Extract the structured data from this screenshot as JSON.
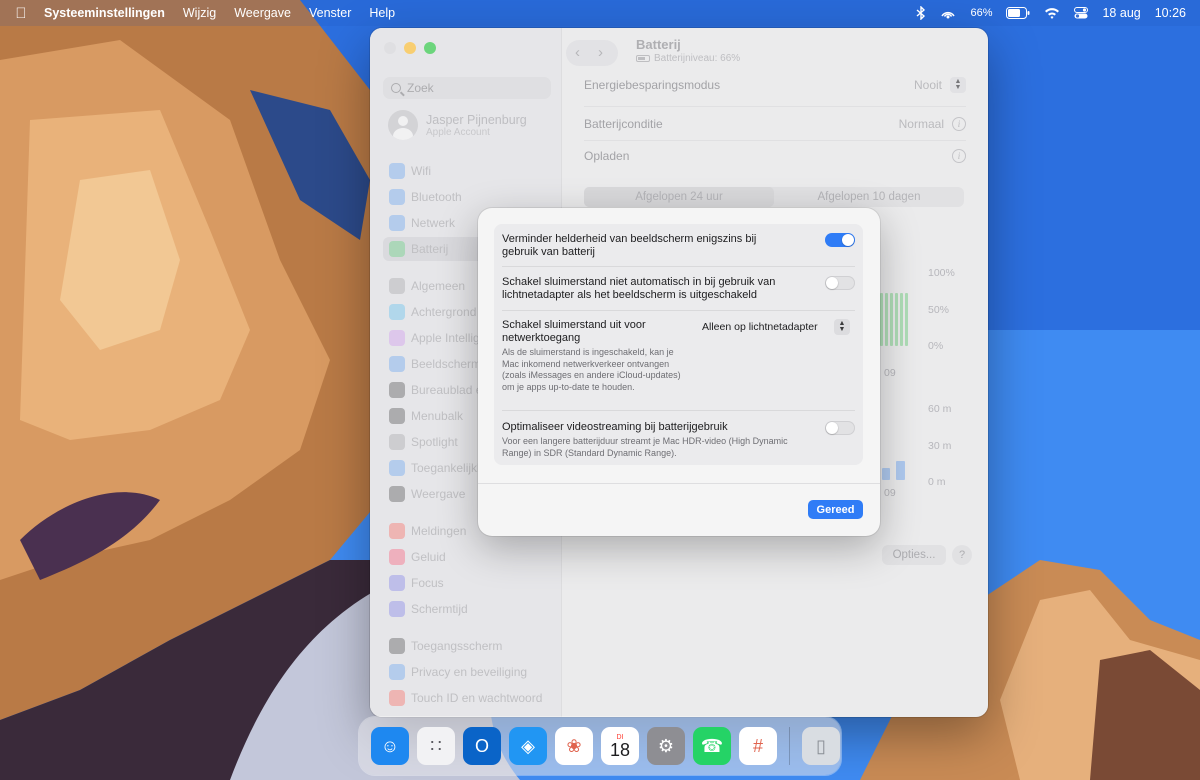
{
  "menubar": {
    "app": "Systeeminstellingen",
    "items": [
      "Wijzig",
      "Weergave",
      "Venster",
      "Help"
    ],
    "battery_pct": "66%",
    "date": "18 aug",
    "time": "10:26"
  },
  "window": {
    "title": "Batterij",
    "subtitle": "Batterijniveau: 66%"
  },
  "sidebar": {
    "search_placeholder": "Zoek",
    "account": {
      "name": "Jasper Pijnenburg",
      "sub": "Apple Account"
    },
    "items": [
      {
        "label": "Wifi",
        "icon": "wifi-icon",
        "color": "#3a8cf5"
      },
      {
        "label": "Bluetooth",
        "icon": "bluetooth-icon",
        "color": "#3a8cf5"
      },
      {
        "label": "Netwerk",
        "icon": "globe-icon",
        "color": "#3a8cf5"
      },
      {
        "label": "Batterij",
        "icon": "battery-icon",
        "color": "#34c759"
      },
      {
        "label": "Algemeen",
        "icon": "gear-icon",
        "color": "#8e8e93"
      },
      {
        "label": "Achtergrond",
        "icon": "wallpaper-icon",
        "color": "#30b0f0"
      },
      {
        "label": "Apple Intellige",
        "icon": "apple-intelligence-icon",
        "color": "#c57af0"
      },
      {
        "label": "Beeldscherme",
        "icon": "display-icon",
        "color": "#3a8cf5"
      },
      {
        "label": "Bureaublad e",
        "icon": "desktop-dock-icon",
        "color": "#1d1d1f"
      },
      {
        "label": "Menubalk",
        "icon": "menubar-icon",
        "color": "#1d1d1f"
      },
      {
        "label": "Spotlight",
        "icon": "spotlight-icon",
        "color": "#8e8e93"
      },
      {
        "label": "Toegankelijkh",
        "icon": "accessibility-icon",
        "color": "#3a8cf5"
      },
      {
        "label": "Weergave",
        "icon": "appearance-icon",
        "color": "#1d1d1f"
      },
      {
        "label": "Meldingen",
        "icon": "notifications-icon",
        "color": "#ff3b30"
      },
      {
        "label": "Geluid",
        "icon": "sound-icon",
        "color": "#ff2d55"
      },
      {
        "label": "Focus",
        "icon": "focus-moon-icon",
        "color": "#5e5ce6"
      },
      {
        "label": "Schermtijd",
        "icon": "screentime-icon",
        "color": "#5e5ce6"
      },
      {
        "label": "Toegangsscherm",
        "icon": "lockscreen-icon",
        "color": "#1d1d1f"
      },
      {
        "label": "Privacy en beveiliging",
        "icon": "privacy-hand-icon",
        "color": "#3a8cf5"
      },
      {
        "label": "Touch ID en wachtwoord",
        "icon": "fingerprint-icon",
        "color": "#ff3b30"
      }
    ]
  },
  "main": {
    "rows": [
      {
        "label": "Energiebesparingsmodus",
        "value": "Nooit"
      },
      {
        "label": "Batterijconditie",
        "value": "Normaal"
      },
      {
        "label": "Opladen",
        "value": ""
      }
    ],
    "segments": [
      "Afgelopen 24 uur",
      "Afgelopen 10 dagen"
    ],
    "chart_level_ticks": [
      "100%",
      "50%",
      "0%"
    ],
    "chart_time_ticks": [
      "60 m",
      "30 m",
      "0 m"
    ],
    "x_tick": "09",
    "options_button": "Opties...",
    "help_button": "?"
  },
  "sheet": {
    "options": [
      {
        "title": "Verminder helderheid van beeldscherm enigszins bij gebruik van batterij",
        "enabled": true
      },
      {
        "title": "Schakel sluimerstand niet automatisch in bij gebruik van lichtnetadapter als het beeldscherm is uitgeschakeld",
        "enabled": false
      },
      {
        "title": "Schakel sluimerstand uit voor netwerktoegang",
        "popup_value": "Alleen op lichtnetadapter",
        "description": "Als de sluimerstand is ingeschakeld, kan je Mac inkomend netwerkverkeer ontvangen (zoals iMessages en andere iCloud-updates) om je apps up-to-date te houden."
      },
      {
        "title": "Optimaliseer videostreaming bij batterijgebruik",
        "enabled": false,
        "description": "Voor een langere batterijduur streamt je Mac HDR-video (High Dynamic Range) in SDR (Standard Dynamic Range)."
      }
    ],
    "done_button": "Gereed"
  },
  "dock": {
    "apps": [
      {
        "name": "finder-icon",
        "color": "#1e88f0"
      },
      {
        "name": "launchpad-icon",
        "color": "#f2f2f4"
      },
      {
        "name": "outlook-icon",
        "color": "#0a64c8"
      },
      {
        "name": "safari-icon",
        "color": "#2196f3"
      },
      {
        "name": "photos-icon",
        "color": "#ffffff"
      },
      {
        "name": "calendar-icon",
        "color": "#ffffff",
        "day": "DI",
        "date": "18"
      },
      {
        "name": "system-settings-icon",
        "color": "#8e8e93"
      },
      {
        "name": "whatsapp-icon",
        "color": "#25d366"
      },
      {
        "name": "slack-icon",
        "color": "#ffffff"
      },
      {
        "name": "trash-icon",
        "color": "#d9dde2"
      }
    ]
  }
}
